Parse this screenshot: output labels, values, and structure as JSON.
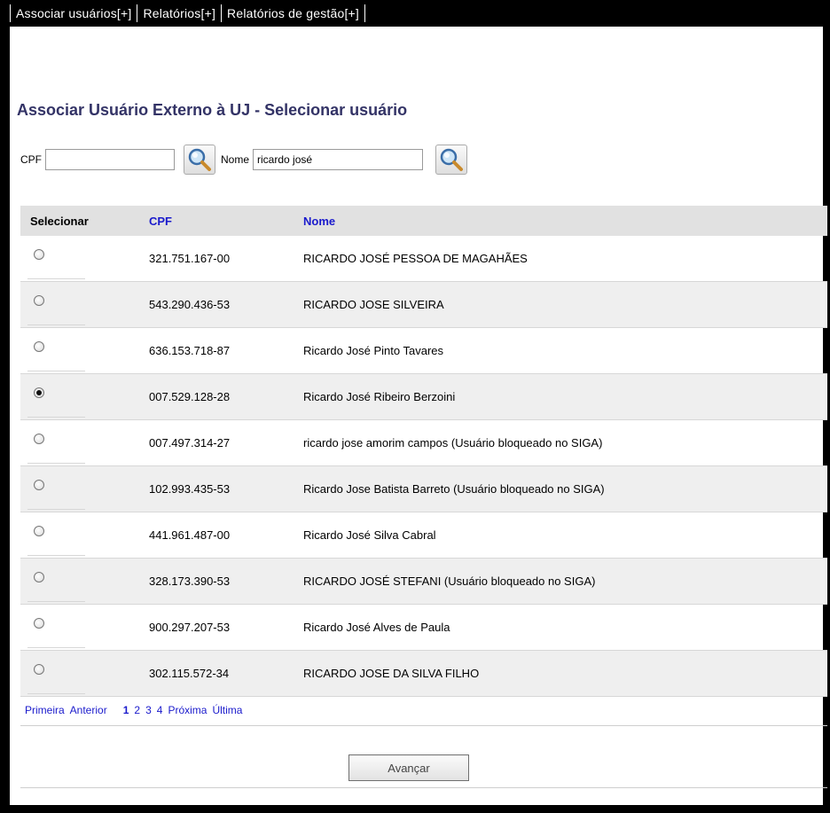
{
  "menu": [
    {
      "label": "Associar usuários[+]"
    },
    {
      "label": "Relatórios[+]"
    },
    {
      "label": "Relatórios de gestão[+]"
    }
  ],
  "page_title": "Associar Usuário Externo à UJ - Selecionar usuário",
  "search": {
    "cpf_label": "CPF",
    "cpf_value": "",
    "nome_label": "Nome",
    "nome_value": "ricardo josé",
    "search_icon": "magnifier-icon"
  },
  "table": {
    "headers": {
      "select": "Selecionar",
      "cpf": "CPF",
      "nome": "Nome"
    },
    "rows": [
      {
        "cpf": "321.751.167-00",
        "nome": "RICARDO JOSÉ PESSOA DE MAGAHÃES",
        "selected": false
      },
      {
        "cpf": "543.290.436-53",
        "nome": "RICARDO JOSE SILVEIRA",
        "selected": false
      },
      {
        "cpf": "636.153.718-87",
        "nome": "Ricardo José Pinto Tavares",
        "selected": false
      },
      {
        "cpf": "007.529.128-28",
        "nome": "Ricardo José Ribeiro Berzoini",
        "selected": true
      },
      {
        "cpf": "007.497.314-27",
        "nome": "ricardo jose amorim campos (Usuário bloqueado no SIGA)",
        "selected": false
      },
      {
        "cpf": "102.993.435-53",
        "nome": "Ricardo Jose Batista Barreto (Usuário bloqueado no SIGA)",
        "selected": false
      },
      {
        "cpf": "441.961.487-00",
        "nome": "Ricardo José Silva Cabral",
        "selected": false
      },
      {
        "cpf": "328.173.390-53",
        "nome": "RICARDO JOSÉ STEFANI (Usuário bloqueado no SIGA)",
        "selected": false
      },
      {
        "cpf": "900.297.207-53",
        "nome": "Ricardo José Alves de Paula",
        "selected": false
      },
      {
        "cpf": "302.115.572-34",
        "nome": "RICARDO JOSE DA SILVA FILHO",
        "selected": false
      }
    ]
  },
  "pagination": {
    "first": "Primeira",
    "previous": "Anterior",
    "pages": [
      "1",
      "2",
      "3",
      "4"
    ],
    "current_page": "1",
    "next": "Próxima",
    "last": "Última"
  },
  "advance_label": "Avançar",
  "colors": {
    "title": "#333366",
    "link": "#1a1acc",
    "header_bg": "#e1e1e1",
    "alt_row": "#efefef"
  }
}
